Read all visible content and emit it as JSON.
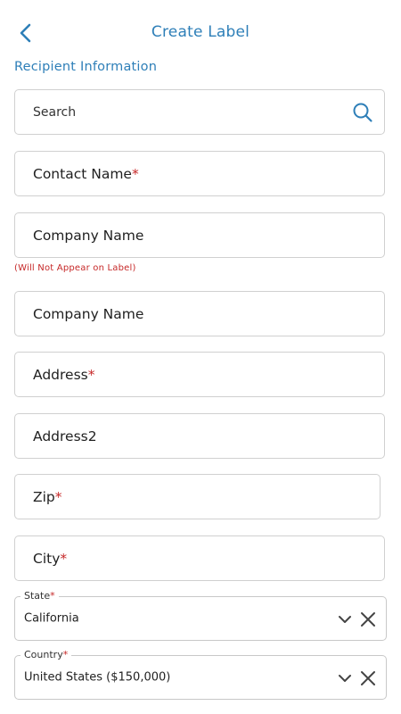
{
  "header": {
    "title": "Create Label",
    "back_icon": "chevron-left-icon"
  },
  "section": {
    "title": "Recipient Information"
  },
  "search": {
    "placeholder": "Search",
    "icon": "search-icon"
  },
  "fields": {
    "contact_name": {
      "label": "Contact Name",
      "required": "*"
    },
    "company_name_internal": {
      "label": "Company Name"
    },
    "company_hint": "(Will Not Appear on Label)",
    "company_name": {
      "label": "Company Name"
    },
    "address": {
      "label": "Address",
      "required": "*"
    },
    "address2": {
      "label": "Address2"
    },
    "zip": {
      "label": "Zip",
      "required": "*"
    },
    "city": {
      "label": "City",
      "required": "*"
    }
  },
  "state": {
    "legend": "State",
    "required": "*",
    "value": "California"
  },
  "country": {
    "legend": "Country",
    "required": "*",
    "value": "United States ($150,000)"
  },
  "colors": {
    "accent": "#2e7fb8",
    "required": "#c62828",
    "border": "#d0d0d0"
  }
}
